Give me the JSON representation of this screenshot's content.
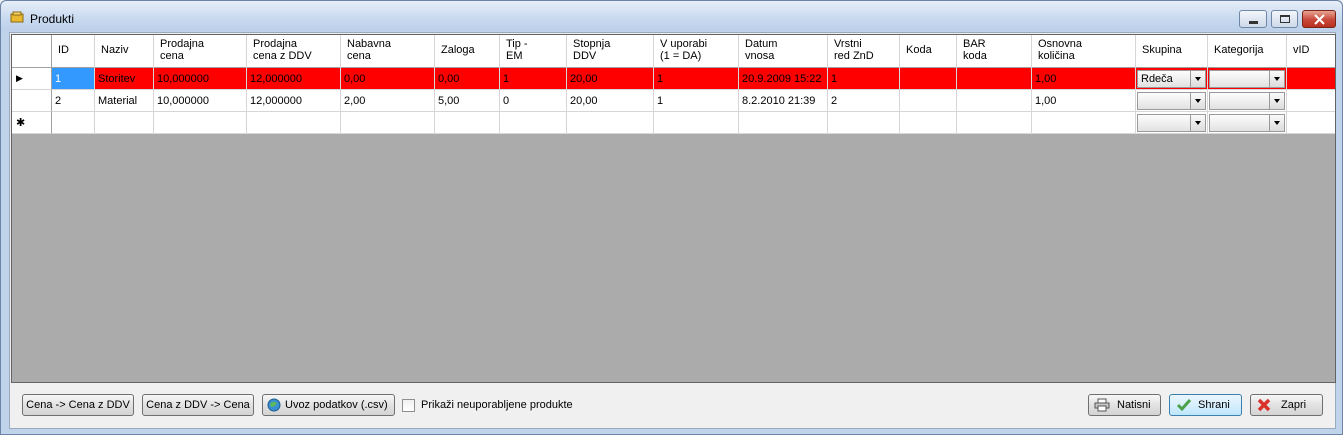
{
  "window": {
    "title": "Produkti"
  },
  "grid": {
    "headers": [
      {
        "id": "id",
        "label": "ID"
      },
      {
        "id": "naziv",
        "label": "Naziv"
      },
      {
        "id": "prodajna-cena",
        "label": "Prodajna\ncena"
      },
      {
        "id": "prodajna-cena-ddv",
        "label": "Prodajna\ncena z DDV"
      },
      {
        "id": "nabavna-cena",
        "label": "Nabavna\ncena"
      },
      {
        "id": "zaloga",
        "label": "Zaloga"
      },
      {
        "id": "tip-em",
        "label": "Tip -\nEM"
      },
      {
        "id": "stopnja-ddv",
        "label": "Stopnja\nDDV"
      },
      {
        "id": "v-uporabi",
        "label": "V uporabi\n(1 = DA)"
      },
      {
        "id": "datum-vnosa",
        "label": "Datum\nvnosa"
      },
      {
        "id": "vrstni-red",
        "label": "Vrstni\nred ZnD"
      },
      {
        "id": "koda",
        "label": "Koda"
      },
      {
        "id": "bar-koda",
        "label": "BAR\nkoda"
      },
      {
        "id": "osnovna-kolicina",
        "label": "Osnovna\nkoličina"
      },
      {
        "id": "skupina",
        "label": "Skupina"
      },
      {
        "id": "kategorija",
        "label": "Kategorija"
      },
      {
        "id": "vid",
        "label": "vID"
      }
    ],
    "rows": [
      {
        "selected": true,
        "cells": [
          "1",
          "Storitev",
          "10,000000",
          "12,000000",
          "0,00",
          "0,00",
          "1",
          "20,00",
          "1",
          "20.9.2009 15:22",
          "1",
          "",
          "",
          "1,00",
          "Rdeča",
          "",
          ""
        ]
      },
      {
        "selected": false,
        "cells": [
          "2",
          "Material",
          "10,000000",
          "12,000000",
          "2,00",
          "5,00",
          "0",
          "20,00",
          "1",
          "8.2.2010 21:39",
          "2",
          "",
          "",
          "1,00",
          "",
          "",
          ""
        ]
      }
    ],
    "new_row_marker": "✱",
    "current_row_marker": "▶"
  },
  "buttons": {
    "cena_to_ddv": "Cena -> Cena z DDV",
    "ddv_to_cena": "Cena z DDV -> Cena",
    "uvoz": "Uvoz podatkov (.csv)",
    "natisni": "Natisni",
    "shrani": "Shrani",
    "zapri": "Zapri"
  },
  "checkbox": {
    "label": "Prikaži neuporabljene produkte",
    "checked": false
  }
}
